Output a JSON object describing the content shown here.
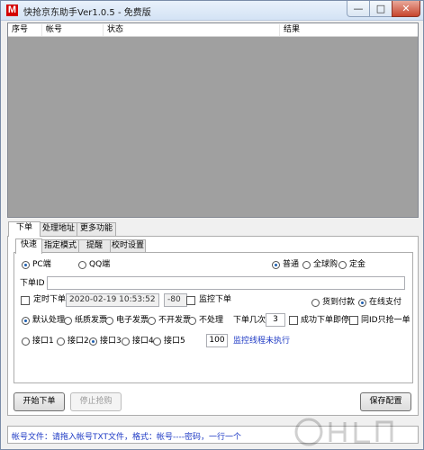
{
  "window": {
    "title": "快抢京东助手Ver1.0.5 - 免费版",
    "icon_letter": "M",
    "min": "—",
    "max": "□",
    "close": "✕"
  },
  "table": {
    "columns": [
      "序号",
      "帐号",
      "状态",
      "结果"
    ],
    "rows": []
  },
  "tabs_top": [
    "下单",
    "处理地址",
    "更多功能"
  ],
  "tabs_inner": [
    "快速",
    "指定模式",
    "提醒",
    "校时设置"
  ],
  "client": {
    "pc_label": "PC端",
    "qq_label": "QQ端",
    "selected": "PC端"
  },
  "purchase_type": {
    "options": [
      "普通",
      "全球购",
      "定金"
    ],
    "selected": "普通"
  },
  "order_id": {
    "label": "下单ID",
    "value": ""
  },
  "timed": {
    "label": "定时下单",
    "datetime": "2020-02-19 10:53:52",
    "offset": "-80",
    "monitor_label": "监控下单"
  },
  "payment": {
    "options": [
      "货到付款",
      "在线支付"
    ],
    "selected": "在线支付"
  },
  "invoice": {
    "options": [
      "默认处理",
      "纸质发票",
      "电子发票",
      "不开发票",
      "不处理"
    ],
    "selected": "默认处理"
  },
  "order_times": {
    "label": "下单几次",
    "value": "3"
  },
  "stop_after_success": "成功下单即停",
  "same_id_once": "同ID只抢一单",
  "interfaces": {
    "options": [
      "接口1",
      "接口2",
      "接口3",
      "接口4",
      "接口5"
    ],
    "selected": "接口3",
    "count": "100",
    "monitor_status": "监控线程未执行"
  },
  "buttons": {
    "start": "开始下单",
    "stop": "停止抢购",
    "save": "保存配置"
  },
  "status": "帐号文件：请拖入帐号TXT文件，格式：帐号----密码，一行一个"
}
